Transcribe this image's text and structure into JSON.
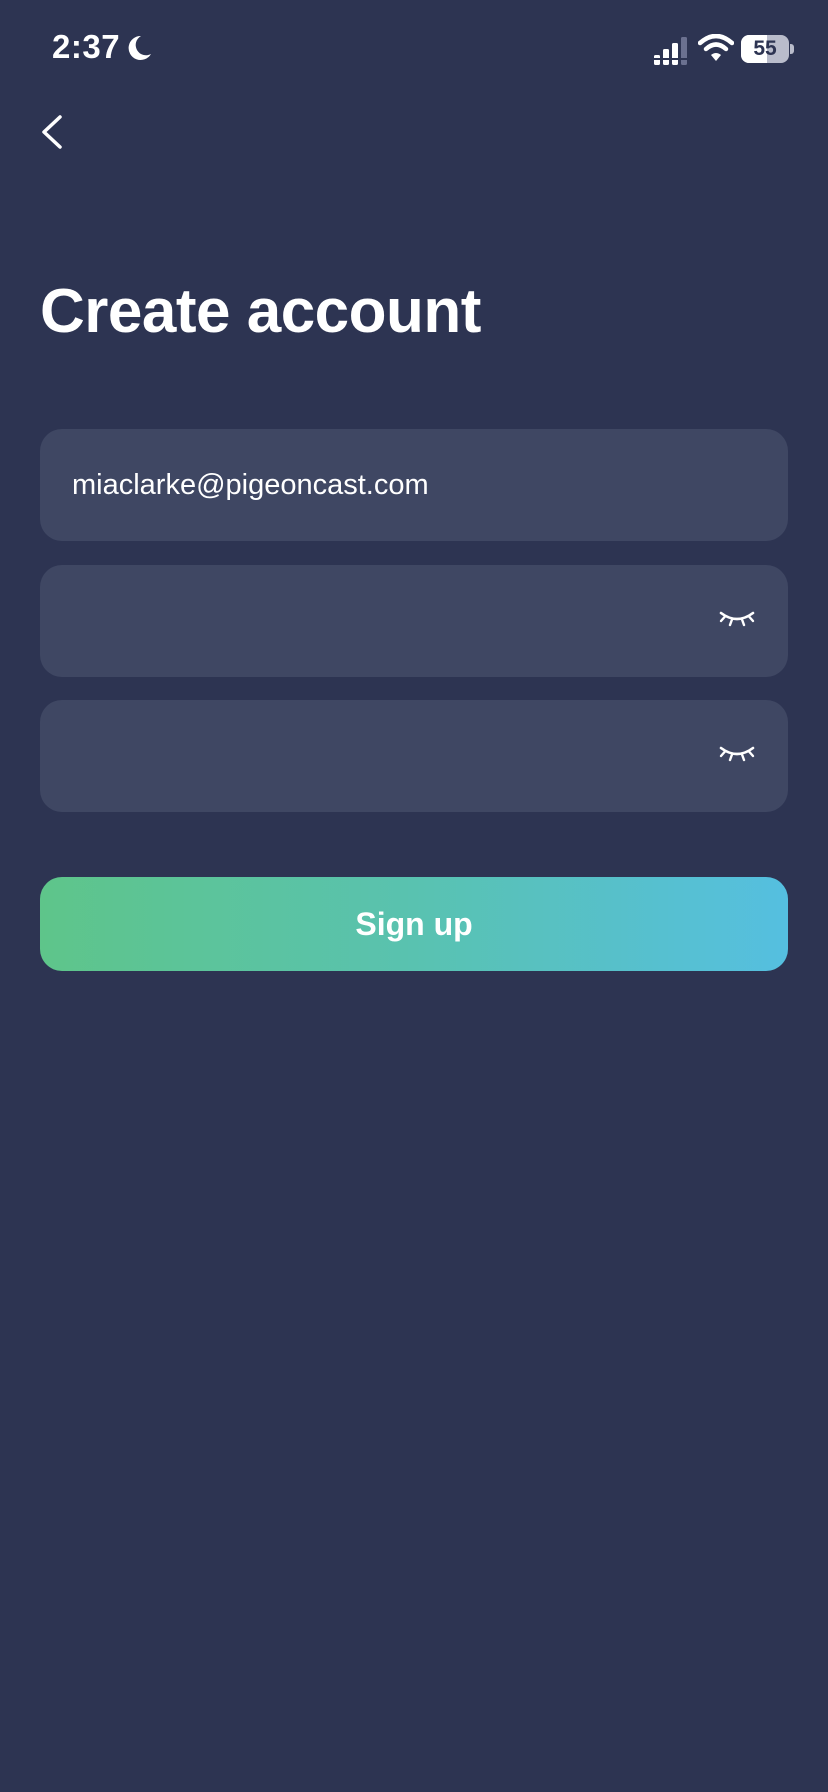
{
  "status_bar": {
    "time": "2:37",
    "battery_level": "55",
    "battery_fraction": 0.55,
    "icons": [
      "moon-icon",
      "signal-icon",
      "wifi-icon",
      "battery-icon"
    ]
  },
  "nav": {
    "back_icon": "chevron-left-icon"
  },
  "page": {
    "title": "Create account"
  },
  "form": {
    "email": {
      "value": "miaclarke@pigeoncast.com",
      "placeholder": ""
    },
    "password": {
      "value": "",
      "placeholder": "",
      "icon": "eye-closed-icon"
    },
    "confirm_password": {
      "value": "",
      "placeholder": "",
      "icon": "eye-closed-icon"
    },
    "submit_label": "Sign up"
  },
  "colors": {
    "background": "#2d3452",
    "field_background": "#3f4763",
    "button_gradient_start": "#5ec58a",
    "button_gradient_end": "#55bfe0",
    "text": "#ffffff"
  }
}
